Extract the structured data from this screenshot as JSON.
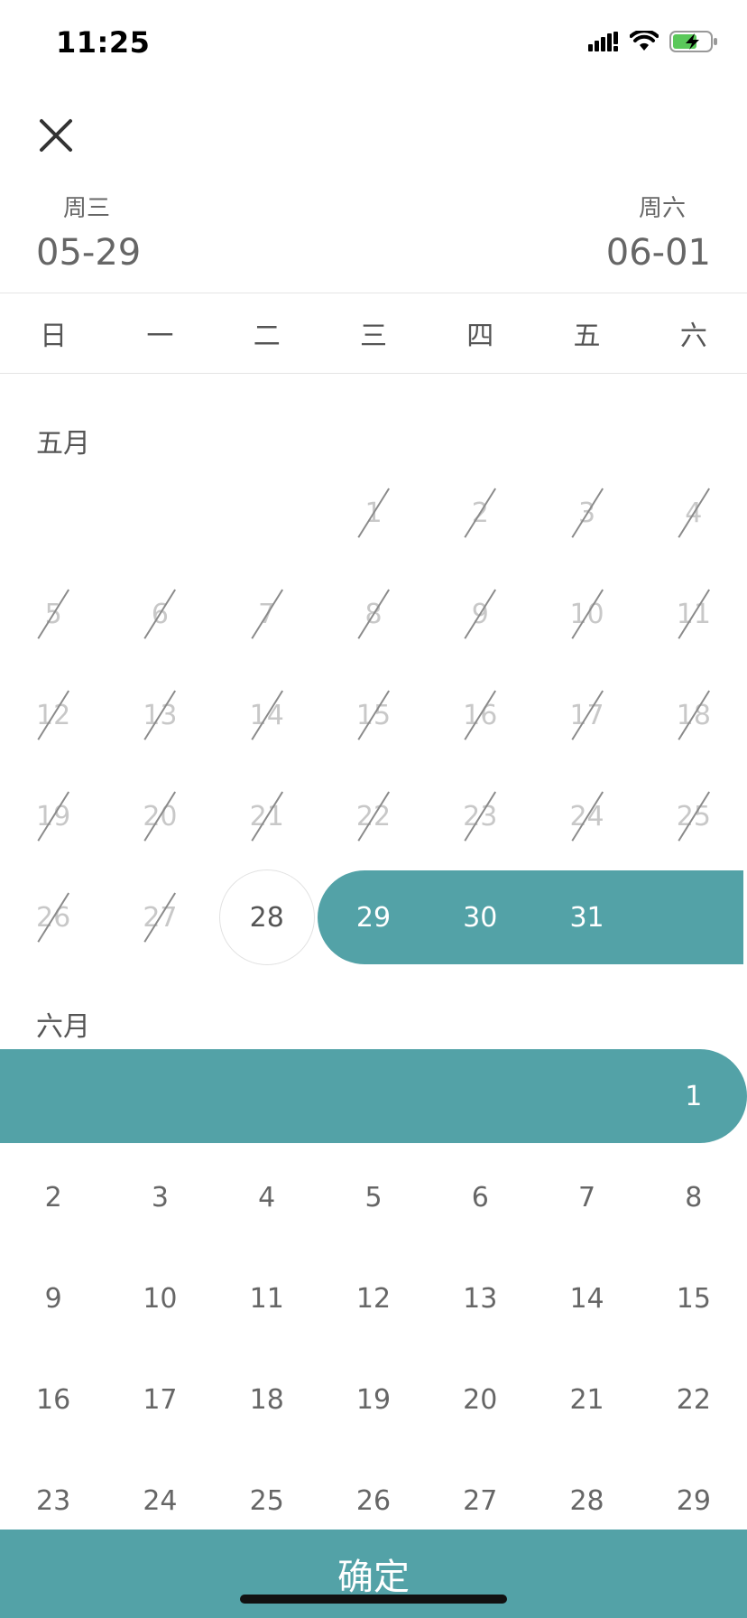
{
  "status_bar": {
    "time": "11:25",
    "icons": [
      "cellular-signal-icon",
      "wifi-icon",
      "battery-charging-icon"
    ]
  },
  "header": {
    "close_icon": "close-icon",
    "start": {
      "weekday": "周三",
      "date": "05-29"
    },
    "end": {
      "weekday": "周六",
      "date": "06-01"
    }
  },
  "weekdays": [
    "日",
    "一",
    "二",
    "三",
    "四",
    "五",
    "六"
  ],
  "may": {
    "label": "五月",
    "first_col": 3,
    "days": [
      {
        "n": "1",
        "s": "past"
      },
      {
        "n": "2",
        "s": "past"
      },
      {
        "n": "3",
        "s": "past"
      },
      {
        "n": "4",
        "s": "past"
      },
      {
        "n": "5",
        "s": "past"
      },
      {
        "n": "6",
        "s": "past"
      },
      {
        "n": "7",
        "s": "past"
      },
      {
        "n": "8",
        "s": "past"
      },
      {
        "n": "9",
        "s": "past"
      },
      {
        "n": "10",
        "s": "past"
      },
      {
        "n": "11",
        "s": "past"
      },
      {
        "n": "12",
        "s": "past"
      },
      {
        "n": "13",
        "s": "past"
      },
      {
        "n": "14",
        "s": "past"
      },
      {
        "n": "15",
        "s": "past"
      },
      {
        "n": "16",
        "s": "past"
      },
      {
        "n": "17",
        "s": "past"
      },
      {
        "n": "18",
        "s": "past"
      },
      {
        "n": "19",
        "s": "past"
      },
      {
        "n": "20",
        "s": "past"
      },
      {
        "n": "21",
        "s": "past"
      },
      {
        "n": "22",
        "s": "past"
      },
      {
        "n": "23",
        "s": "past"
      },
      {
        "n": "24",
        "s": "past"
      },
      {
        "n": "25",
        "s": "past"
      },
      {
        "n": "26",
        "s": "past"
      },
      {
        "n": "27",
        "s": "past"
      },
      {
        "n": "28",
        "s": "today"
      },
      {
        "n": "29",
        "s": "sel"
      },
      {
        "n": "30",
        "s": "sel"
      },
      {
        "n": "31",
        "s": "sel"
      }
    ]
  },
  "june": {
    "label": "六月",
    "first_col": 6,
    "days": [
      {
        "n": "1",
        "s": "sel"
      },
      {
        "n": "2",
        "s": "normal"
      },
      {
        "n": "3",
        "s": "normal"
      },
      {
        "n": "4",
        "s": "normal"
      },
      {
        "n": "5",
        "s": "normal"
      },
      {
        "n": "6",
        "s": "normal"
      },
      {
        "n": "7",
        "s": "normal"
      },
      {
        "n": "8",
        "s": "normal"
      },
      {
        "n": "9",
        "s": "normal"
      },
      {
        "n": "10",
        "s": "normal"
      },
      {
        "n": "11",
        "s": "normal"
      },
      {
        "n": "12",
        "s": "normal"
      },
      {
        "n": "13",
        "s": "normal"
      },
      {
        "n": "14",
        "s": "normal"
      },
      {
        "n": "15",
        "s": "normal"
      },
      {
        "n": "16",
        "s": "normal"
      },
      {
        "n": "17",
        "s": "normal"
      },
      {
        "n": "18",
        "s": "normal"
      },
      {
        "n": "19",
        "s": "normal"
      },
      {
        "n": "20",
        "s": "normal"
      },
      {
        "n": "21",
        "s": "normal"
      },
      {
        "n": "22",
        "s": "normal"
      },
      {
        "n": "23",
        "s": "normal"
      },
      {
        "n": "24",
        "s": "normal"
      },
      {
        "n": "25",
        "s": "normal"
      },
      {
        "n": "26",
        "s": "normal"
      },
      {
        "n": "27",
        "s": "normal"
      },
      {
        "n": "28",
        "s": "normal"
      },
      {
        "n": "29",
        "s": "normal"
      }
    ]
  },
  "confirm_label": "确定",
  "colors": {
    "accent": "#53a2a7",
    "text": "#666666",
    "past_text": "#c8c8c8"
  }
}
